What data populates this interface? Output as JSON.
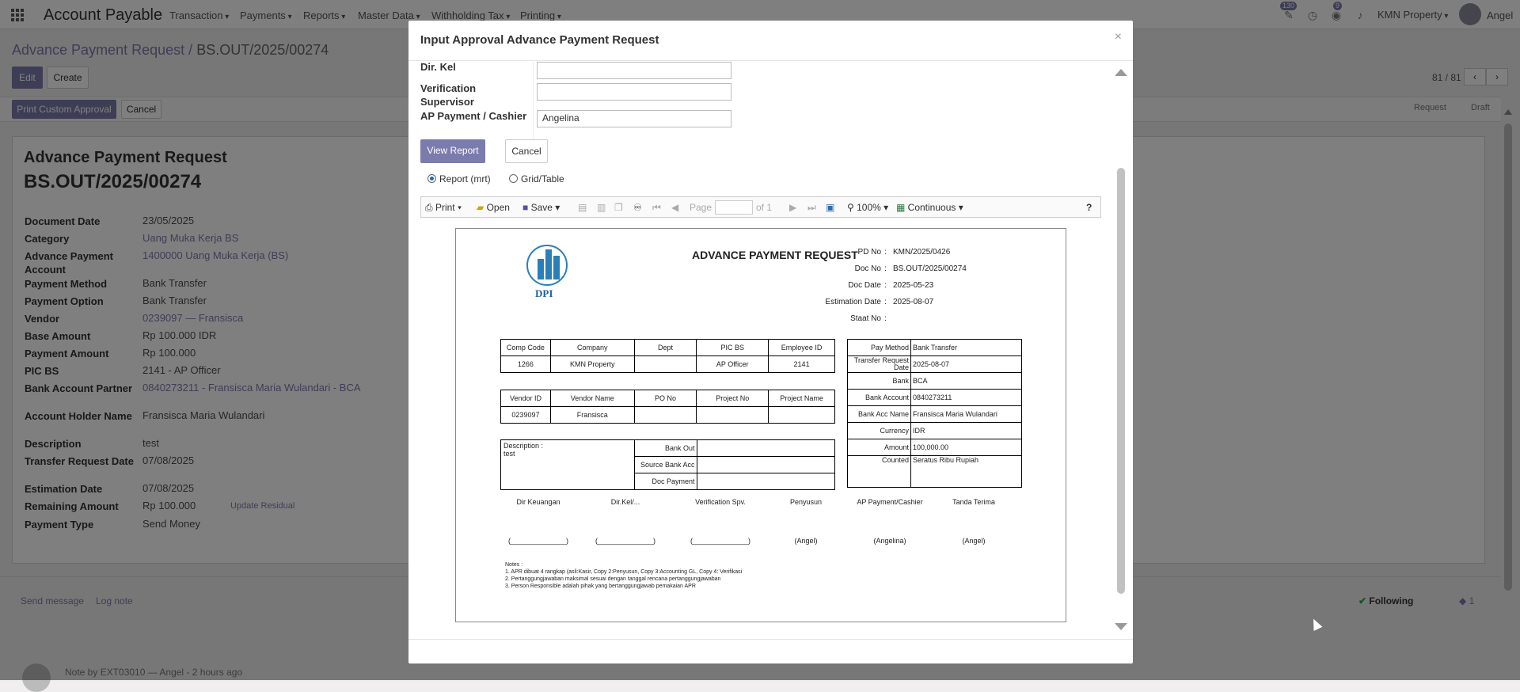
{
  "app": {
    "name": "Account Payable"
  },
  "topnav": {
    "menus": [
      "Transaction",
      "Payments",
      "Reports",
      "Master Data",
      "Withholding Tax",
      "Printing"
    ],
    "activity_badge": "130",
    "chat_badge": "9",
    "company": "KMN Property",
    "user": "Angel"
  },
  "breadcrumb": {
    "parent": "Advance Payment Request",
    "sep": "/",
    "current": "BS.OUT/2025/00274"
  },
  "control": {
    "edit": "Edit",
    "create": "Create",
    "print_custom": "Print Custom Approval",
    "cancel": "Cancel",
    "pager": "81 / 81"
  },
  "stages": [
    "Request",
    "Draft"
  ],
  "record": {
    "title": "Advance Payment Request",
    "number": "BS.OUT/2025/00274",
    "fields": [
      {
        "label": "Document Date",
        "value": "23/05/2025",
        "link": false
      },
      {
        "label": "Category",
        "value": "Uang Muka Kerja BS",
        "link": true
      },
      {
        "label": "Advance Payment Account",
        "value": "1400000 Uang Muka Kerja (BS)",
        "link": true
      },
      {
        "label": "Payment Method",
        "value": "Bank Transfer",
        "link": false
      },
      {
        "label": "Payment Option",
        "value": "Bank Transfer",
        "link": false
      },
      {
        "label": "Vendor",
        "value": "0239097 — Fransisca",
        "link": true
      },
      {
        "label": "Base Amount",
        "value": "Rp 100.000 IDR",
        "link": false
      },
      {
        "label": "Payment Amount",
        "value": "Rp 100.000",
        "link": false
      },
      {
        "label": "PIC BS",
        "value": "2141 - AP Officer",
        "link": false
      },
      {
        "label": "Bank Account Partner",
        "value": "0840273211 - Fransisca Maria Wulandari - BCA",
        "link": true
      },
      {
        "label": "Account Holder Name",
        "value": "Fransisca Maria Wulandari",
        "link": false
      },
      {
        "label": "Description",
        "value": "test",
        "link": false
      },
      {
        "label": "Transfer Request Date",
        "value": "07/08/2025",
        "link": false
      },
      {
        "label": "Estimation Date",
        "value": "07/08/2025",
        "link": false
      },
      {
        "label": "Remaining Amount",
        "value": "Rp 100.000",
        "link": false
      },
      {
        "label": "Payment Type",
        "value": "Send Money",
        "link": false
      }
    ],
    "update_residual": "Update Residual"
  },
  "chatter": {
    "send_message": "Send message",
    "log_note": "Log note",
    "following": "Following",
    "followers": "1",
    "note": "Note by EXT03010 — Angel - 2 hours ago"
  },
  "modal": {
    "title": "Input Approval Advance Payment Request",
    "close": "×",
    "fields": [
      {
        "label": "Dir. Kel",
        "value": ""
      },
      {
        "label": "Verification Supervisor",
        "value": ""
      },
      {
        "label": "AP Payment / Cashier",
        "value": "Angelina"
      }
    ],
    "view_report": "View Report",
    "cancel": "Cancel",
    "radio_report": "Report (mrt)",
    "radio_grid": "Grid/Table",
    "toolbar": {
      "print": "Print",
      "open": "Open",
      "save": "Save",
      "page_label": "Page",
      "page_of": "of 1",
      "zoom": "100%",
      "view": "Continuous",
      "help": "?"
    }
  },
  "report": {
    "title": "ADVANCE PAYMENT REQUEST",
    "logo_text": "DPI",
    "header": [
      {
        "label": "PD No",
        "value": "KMN/2025/0426"
      },
      {
        "label": "Doc No",
        "value": "BS.OUT/2025/00274"
      },
      {
        "label": "Doc Date",
        "value": "2025-05-23"
      },
      {
        "label": "Estimation Date",
        "value": "2025-08-07"
      },
      {
        "label": "Staat No",
        "value": ""
      }
    ],
    "table1": {
      "headers": [
        "Comp Code",
        "Company",
        "Dept",
        "PIC BS",
        "Employee ID"
      ],
      "row": [
        "1266",
        "KMN Property",
        "",
        "AP Officer",
        "2141"
      ]
    },
    "table2": {
      "headers": [
        "Vendor ID",
        "Vendor Name",
        "PO No",
        "Project No",
        "Project Name"
      ],
      "row": [
        "0239097",
        "Fransisca",
        "",
        "",
        ""
      ]
    },
    "desc_label": "Description :",
    "desc_value": "test",
    "bank_rows": [
      "Bank Out",
      "Source Bank Acc",
      "Doc Payment"
    ],
    "pay": [
      {
        "label": "Pay Method",
        "value": "Bank Transfer"
      },
      {
        "label": "Transfer Request Date",
        "value": "2025-08-07"
      },
      {
        "label": "Bank",
        "value": "BCA"
      },
      {
        "label": "Bank Account",
        "value": "0840273211"
      },
      {
        "label": "Bank Acc Name",
        "value": "Fransisca Maria Wulandari"
      },
      {
        "label": "Currency",
        "value": "IDR"
      },
      {
        "label": "Amount",
        "value": "100,000.00"
      },
      {
        "label": "Counted",
        "value": "Seratus Ribu Rupiah"
      }
    ],
    "signers": [
      {
        "role": "Dir Keuangan",
        "name": "(______________)"
      },
      {
        "role": "Dir.Kel/...",
        "name": "(______________)"
      },
      {
        "role": "Verification Spv.",
        "name": "(______________)"
      },
      {
        "role": "Penyusun",
        "name": "(Angel)"
      },
      {
        "role": "AP Payment/Cashier",
        "name": "(Angelina)"
      },
      {
        "role": "Tanda Terima",
        "name": "(Angel)"
      }
    ],
    "notes": [
      "Notes :",
      "1. APR dibuat 4 rangkap (asli:Kasir, Copy 2:Penyusun, Copy 3:Accounting GL, Copy 4: Verifikasi",
      "2. Pertanggungjawaban maksimal sesuai dengan tanggal rencana pertanggungjawaban",
      "3. Person Responsible adalah pihak yang bertanggungjawab pemakaian APR"
    ]
  }
}
